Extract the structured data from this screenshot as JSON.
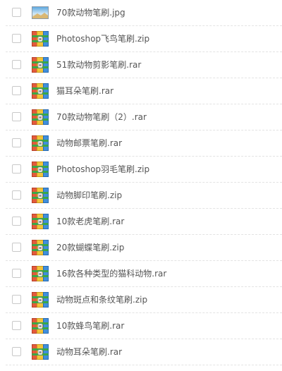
{
  "files": [
    {
      "name": "70款动物笔刷.jpg",
      "icon": "image-file-icon"
    },
    {
      "name": "Photoshop飞鸟笔刷.zip",
      "icon": "archive-file-icon"
    },
    {
      "name": "51款动物剪影笔刷.rar",
      "icon": "archive-file-icon"
    },
    {
      "name": "猫耳朵笔刷.rar",
      "icon": "archive-file-icon"
    },
    {
      "name": "70款动物笔刷（2）.rar",
      "icon": "archive-file-icon"
    },
    {
      "name": "动物邮票笔刷.rar",
      "icon": "archive-file-icon"
    },
    {
      "name": "Photoshop羽毛笔刷.zip",
      "icon": "archive-file-icon"
    },
    {
      "name": "动物脚印笔刷.zip",
      "icon": "archive-file-icon"
    },
    {
      "name": "10款老虎笔刷.rar",
      "icon": "archive-file-icon"
    },
    {
      "name": "20款蝴蝶笔刷.zip",
      "icon": "archive-file-icon"
    },
    {
      "name": "16款各种类型的猫科动物.rar",
      "icon": "archive-file-icon"
    },
    {
      "name": "动物斑点和条纹笔刷.zip",
      "icon": "archive-file-icon"
    },
    {
      "name": "10款蜂鸟笔刷.rar",
      "icon": "archive-file-icon"
    },
    {
      "name": "动物耳朵笔刷.rar",
      "icon": "archive-file-icon"
    }
  ]
}
